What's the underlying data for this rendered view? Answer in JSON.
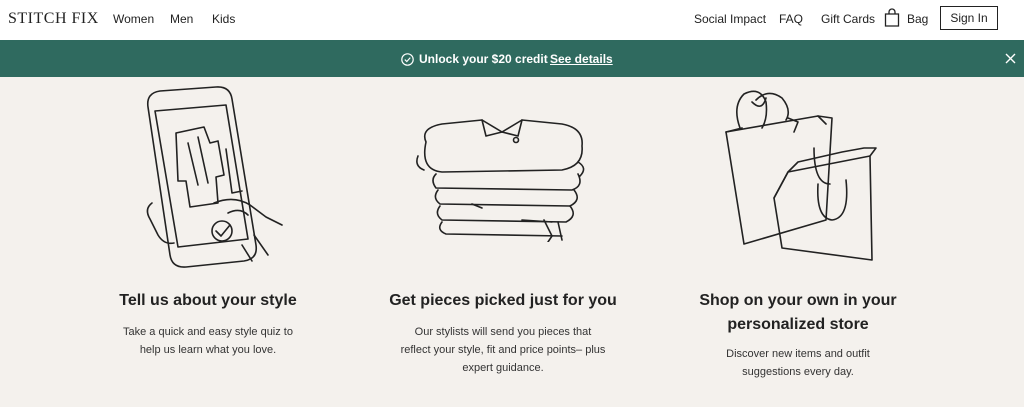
{
  "nav": {
    "logo": "STITCH FIX",
    "links": [
      "Women",
      "Men",
      "Kids"
    ],
    "right_links": [
      "Social Impact",
      "FAQ",
      "Gift Cards"
    ],
    "bag_label": "Bag",
    "bag_icon": "shopping-bag-icon",
    "signin_label": "Sign In"
  },
  "banner": {
    "background": "#2f6a5f",
    "icon": "check-circle-icon",
    "promo_text": "Unlock your $20 credit",
    "details_link": "See details",
    "close_icon": "close-icon"
  },
  "steps": [
    {
      "illustration": "phone-style-quiz-illustration",
      "title": "Tell us about your style",
      "description": "Take a quick and easy style quiz to help us learn what you love."
    },
    {
      "illustration": "folded-clothes-stack-illustration",
      "title": "Get pieces picked just for you",
      "description": "Our stylists will send you pieces that reflect your style, fit and price points– plus expert guidance."
    },
    {
      "illustration": "shopping-bags-illustration",
      "title": "Shop on your own in your personalized store",
      "description": "Discover new items and outfit suggestions every day."
    }
  ]
}
